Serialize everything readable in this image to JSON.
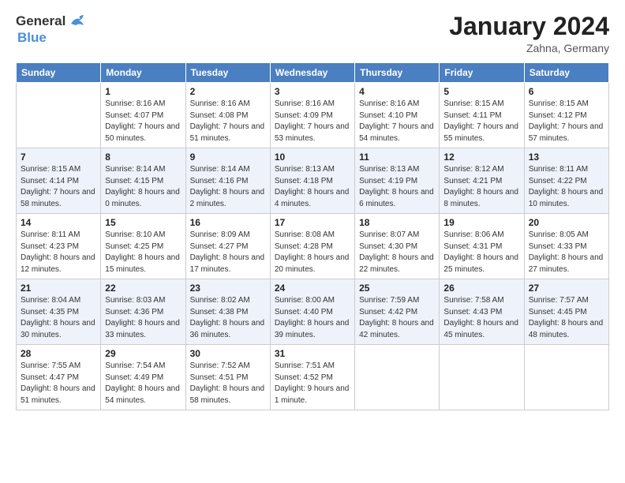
{
  "header": {
    "logo_general": "General",
    "logo_blue": "Blue",
    "month_title": "January 2024",
    "location": "Zahna, Germany"
  },
  "weekdays": [
    "Sunday",
    "Monday",
    "Tuesday",
    "Wednesday",
    "Thursday",
    "Friday",
    "Saturday"
  ],
  "weeks": [
    [
      {
        "day": "",
        "sunrise": "",
        "sunset": "",
        "daylight": ""
      },
      {
        "day": "1",
        "sunrise": "Sunrise: 8:16 AM",
        "sunset": "Sunset: 4:07 PM",
        "daylight": "Daylight: 7 hours and 50 minutes."
      },
      {
        "day": "2",
        "sunrise": "Sunrise: 8:16 AM",
        "sunset": "Sunset: 4:08 PM",
        "daylight": "Daylight: 7 hours and 51 minutes."
      },
      {
        "day": "3",
        "sunrise": "Sunrise: 8:16 AM",
        "sunset": "Sunset: 4:09 PM",
        "daylight": "Daylight: 7 hours and 53 minutes."
      },
      {
        "day": "4",
        "sunrise": "Sunrise: 8:16 AM",
        "sunset": "Sunset: 4:10 PM",
        "daylight": "Daylight: 7 hours and 54 minutes."
      },
      {
        "day": "5",
        "sunrise": "Sunrise: 8:15 AM",
        "sunset": "Sunset: 4:11 PM",
        "daylight": "Daylight: 7 hours and 55 minutes."
      },
      {
        "day": "6",
        "sunrise": "Sunrise: 8:15 AM",
        "sunset": "Sunset: 4:12 PM",
        "daylight": "Daylight: 7 hours and 57 minutes."
      }
    ],
    [
      {
        "day": "7",
        "sunrise": "Sunrise: 8:15 AM",
        "sunset": "Sunset: 4:14 PM",
        "daylight": "Daylight: 7 hours and 58 minutes."
      },
      {
        "day": "8",
        "sunrise": "Sunrise: 8:14 AM",
        "sunset": "Sunset: 4:15 PM",
        "daylight": "Daylight: 8 hours and 0 minutes."
      },
      {
        "day": "9",
        "sunrise": "Sunrise: 8:14 AM",
        "sunset": "Sunset: 4:16 PM",
        "daylight": "Daylight: 8 hours and 2 minutes."
      },
      {
        "day": "10",
        "sunrise": "Sunrise: 8:13 AM",
        "sunset": "Sunset: 4:18 PM",
        "daylight": "Daylight: 8 hours and 4 minutes."
      },
      {
        "day": "11",
        "sunrise": "Sunrise: 8:13 AM",
        "sunset": "Sunset: 4:19 PM",
        "daylight": "Daylight: 8 hours and 6 minutes."
      },
      {
        "day": "12",
        "sunrise": "Sunrise: 8:12 AM",
        "sunset": "Sunset: 4:21 PM",
        "daylight": "Daylight: 8 hours and 8 minutes."
      },
      {
        "day": "13",
        "sunrise": "Sunrise: 8:11 AM",
        "sunset": "Sunset: 4:22 PM",
        "daylight": "Daylight: 8 hours and 10 minutes."
      }
    ],
    [
      {
        "day": "14",
        "sunrise": "Sunrise: 8:11 AM",
        "sunset": "Sunset: 4:23 PM",
        "daylight": "Daylight: 8 hours and 12 minutes."
      },
      {
        "day": "15",
        "sunrise": "Sunrise: 8:10 AM",
        "sunset": "Sunset: 4:25 PM",
        "daylight": "Daylight: 8 hours and 15 minutes."
      },
      {
        "day": "16",
        "sunrise": "Sunrise: 8:09 AM",
        "sunset": "Sunset: 4:27 PM",
        "daylight": "Daylight: 8 hours and 17 minutes."
      },
      {
        "day": "17",
        "sunrise": "Sunrise: 8:08 AM",
        "sunset": "Sunset: 4:28 PM",
        "daylight": "Daylight: 8 hours and 20 minutes."
      },
      {
        "day": "18",
        "sunrise": "Sunrise: 8:07 AM",
        "sunset": "Sunset: 4:30 PM",
        "daylight": "Daylight: 8 hours and 22 minutes."
      },
      {
        "day": "19",
        "sunrise": "Sunrise: 8:06 AM",
        "sunset": "Sunset: 4:31 PM",
        "daylight": "Daylight: 8 hours and 25 minutes."
      },
      {
        "day": "20",
        "sunrise": "Sunrise: 8:05 AM",
        "sunset": "Sunset: 4:33 PM",
        "daylight": "Daylight: 8 hours and 27 minutes."
      }
    ],
    [
      {
        "day": "21",
        "sunrise": "Sunrise: 8:04 AM",
        "sunset": "Sunset: 4:35 PM",
        "daylight": "Daylight: 8 hours and 30 minutes."
      },
      {
        "day": "22",
        "sunrise": "Sunrise: 8:03 AM",
        "sunset": "Sunset: 4:36 PM",
        "daylight": "Daylight: 8 hours and 33 minutes."
      },
      {
        "day": "23",
        "sunrise": "Sunrise: 8:02 AM",
        "sunset": "Sunset: 4:38 PM",
        "daylight": "Daylight: 8 hours and 36 minutes."
      },
      {
        "day": "24",
        "sunrise": "Sunrise: 8:00 AM",
        "sunset": "Sunset: 4:40 PM",
        "daylight": "Daylight: 8 hours and 39 minutes."
      },
      {
        "day": "25",
        "sunrise": "Sunrise: 7:59 AM",
        "sunset": "Sunset: 4:42 PM",
        "daylight": "Daylight: 8 hours and 42 minutes."
      },
      {
        "day": "26",
        "sunrise": "Sunrise: 7:58 AM",
        "sunset": "Sunset: 4:43 PM",
        "daylight": "Daylight: 8 hours and 45 minutes."
      },
      {
        "day": "27",
        "sunrise": "Sunrise: 7:57 AM",
        "sunset": "Sunset: 4:45 PM",
        "daylight": "Daylight: 8 hours and 48 minutes."
      }
    ],
    [
      {
        "day": "28",
        "sunrise": "Sunrise: 7:55 AM",
        "sunset": "Sunset: 4:47 PM",
        "daylight": "Daylight: 8 hours and 51 minutes."
      },
      {
        "day": "29",
        "sunrise": "Sunrise: 7:54 AM",
        "sunset": "Sunset: 4:49 PM",
        "daylight": "Daylight: 8 hours and 54 minutes."
      },
      {
        "day": "30",
        "sunrise": "Sunrise: 7:52 AM",
        "sunset": "Sunset: 4:51 PM",
        "daylight": "Daylight: 8 hours and 58 minutes."
      },
      {
        "day": "31",
        "sunrise": "Sunrise: 7:51 AM",
        "sunset": "Sunset: 4:52 PM",
        "daylight": "Daylight: 9 hours and 1 minute."
      },
      {
        "day": "",
        "sunrise": "",
        "sunset": "",
        "daylight": ""
      },
      {
        "day": "",
        "sunrise": "",
        "sunset": "",
        "daylight": ""
      },
      {
        "day": "",
        "sunrise": "",
        "sunset": "",
        "daylight": ""
      }
    ]
  ]
}
